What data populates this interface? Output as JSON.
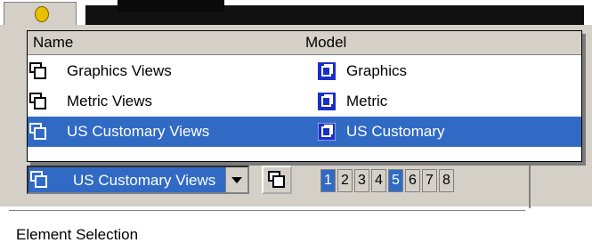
{
  "dropdown": {
    "col_name": "Name",
    "col_model": "Model",
    "rows": [
      {
        "name": "Graphics Views",
        "model": "Graphics",
        "selected": false
      },
      {
        "name": "Metric Views",
        "model": "Metric",
        "selected": false
      },
      {
        "name": "US Customary Views",
        "model": "US Customary",
        "selected": true
      }
    ]
  },
  "combo": {
    "value": "US Customary Views"
  },
  "pager": {
    "pages": [
      "1",
      "2",
      "3",
      "4",
      "5",
      "6",
      "7",
      "8"
    ],
    "active": [
      "1",
      "5"
    ]
  },
  "panel": {
    "section_label": "Element Selection"
  },
  "colors": {
    "selection": "#316ac5",
    "face": "#d4d0c8"
  },
  "icons": {
    "view": "views-icon",
    "model": "model-icon"
  }
}
